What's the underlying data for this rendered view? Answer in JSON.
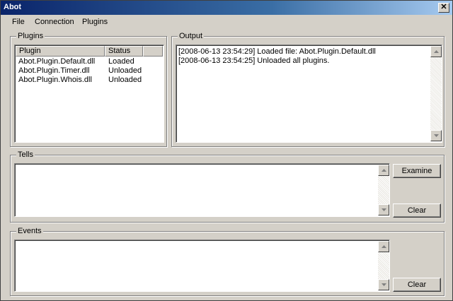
{
  "window": {
    "title": "Abot",
    "close_glyph": "✕"
  },
  "menu": [
    "File",
    "Connection",
    "Plugins"
  ],
  "plugins": {
    "label": "Plugins",
    "columns": [
      "Plugin",
      "Status"
    ],
    "rows": [
      {
        "name": "Abot.Plugin.Default.dll",
        "status": "Loaded"
      },
      {
        "name": "Abot.Plugin.Timer.dll",
        "status": "Unloaded"
      },
      {
        "name": "Abot.Plugin.Whois.dll",
        "status": "Unloaded"
      }
    ]
  },
  "output": {
    "label": "Output",
    "lines": [
      "[2008-06-13 23:54:29] Loaded file: Abot.Plugin.Default.dll",
      "[2008-06-13 23:54:25] Unloaded all plugins."
    ]
  },
  "tells": {
    "label": "Tells",
    "examine_label": "Examine",
    "clear_label": "Clear"
  },
  "events": {
    "label": "Events",
    "clear_label": "Clear"
  }
}
